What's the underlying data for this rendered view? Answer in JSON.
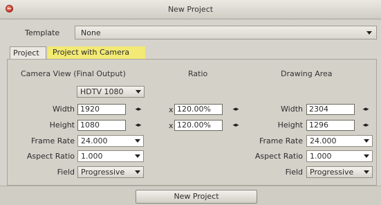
{
  "window": {
    "title": "New Project"
  },
  "template": {
    "label": "Template",
    "value": "None"
  },
  "tabs": [
    {
      "label": "Project"
    },
    {
      "label": "Project with Camera",
      "active": true,
      "highlight_color": "#f2ea74"
    }
  ],
  "camera_view": {
    "heading": "Camera View (Final Output)",
    "preset": "HDTV 1080",
    "width_label": "Width",
    "width": "1920",
    "height_label": "Height",
    "height": "1080",
    "frame_rate_label": "Frame Rate",
    "frame_rate": "24.000",
    "aspect_ratio_label": "Aspect Ratio",
    "aspect_ratio": "1.000",
    "field_label": "Field",
    "field": "Progressive"
  },
  "ratio": {
    "heading": "Ratio",
    "prefix": "x",
    "width_ratio": "120.00%",
    "height_ratio": "120.00%"
  },
  "drawing_area": {
    "heading": "Drawing Area",
    "width_label": "Width",
    "width": "2304",
    "height_label": "Height",
    "height": "1296",
    "frame_rate_label": "Frame Rate",
    "frame_rate": "24.000",
    "aspect_ratio_label": "Aspect Ratio",
    "aspect_ratio": "1.000",
    "field_label": "Field",
    "field": "Progressive"
  },
  "footer": {
    "button_label": "New Project"
  },
  "icons": {
    "close": "close-icon",
    "stepper": "stepper-arrows-icon",
    "dropdown": "chevron-down-icon"
  }
}
